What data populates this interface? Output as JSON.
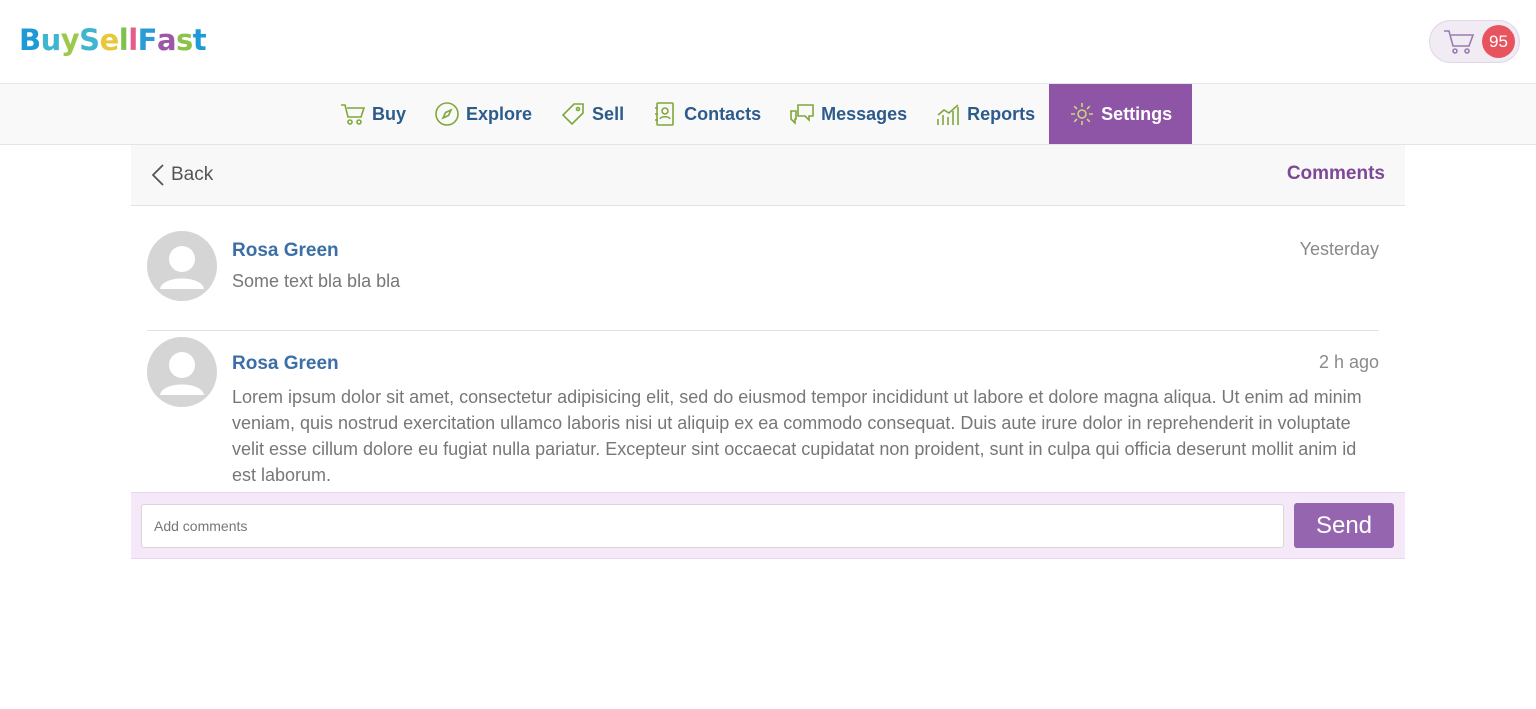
{
  "brand": {
    "logo_letters": [
      "B",
      "u",
      "y",
      "S",
      "e",
      "l",
      "l",
      "F",
      "a",
      "s",
      "t"
    ],
    "logo_colors": [
      "#1e9bd7",
      "#3fb5d0",
      "#9cc84b",
      "#3fb5d0",
      "#e6c93a",
      "#7dc14f",
      "#e85a8c",
      "#2b9bd6",
      "#9d57a8",
      "#8bc34a",
      "#1e9bd7"
    ]
  },
  "cart": {
    "icon": "cart-icon",
    "count": "95"
  },
  "nav": {
    "items": [
      {
        "label": "Buy",
        "icon": "cart-icon"
      },
      {
        "label": "Explore",
        "icon": "compass-icon"
      },
      {
        "label": "Sell",
        "icon": "tag-icon"
      },
      {
        "label": "Contacts",
        "icon": "address-book-icon"
      },
      {
        "label": "Messages",
        "icon": "chat-bubbles-icon"
      },
      {
        "label": "Reports",
        "icon": "bar-chart-icon"
      },
      {
        "label": "Settings",
        "icon": "gear-icon",
        "active": true
      }
    ]
  },
  "panel": {
    "back_label": "Back",
    "title": "Comments"
  },
  "comments": [
    {
      "author": "Rosa Green",
      "time": "Yesterday",
      "text": "Some text bla bla bla"
    },
    {
      "author": "Rosa Green",
      "time": "2 h ago",
      "text": "Lorem ipsum dolor sit amet, consectetur adipisicing elit, sed do eiusmod tempor incididunt ut labore et dolore magna aliqua. Ut enim ad minim veniam, quis nostrud exercitation ullamco laboris nisi ut aliquip ex ea commodo consequat. Duis aute irure dolor in reprehenderit in voluptate velit esse cillum dolore eu fugiat nulla pariatur. Excepteur sint occaecat cupidatat non proident, sunt in culpa qui officia deserunt mollit anim id est laborum."
    }
  ],
  "composer": {
    "placeholder": "Add comments",
    "send_label": "Send"
  },
  "colors": {
    "accent": "#8e54a6",
    "nav_text": "#2d5b8c",
    "icon_green": "#7fa83a",
    "badge": "#e8545e"
  }
}
